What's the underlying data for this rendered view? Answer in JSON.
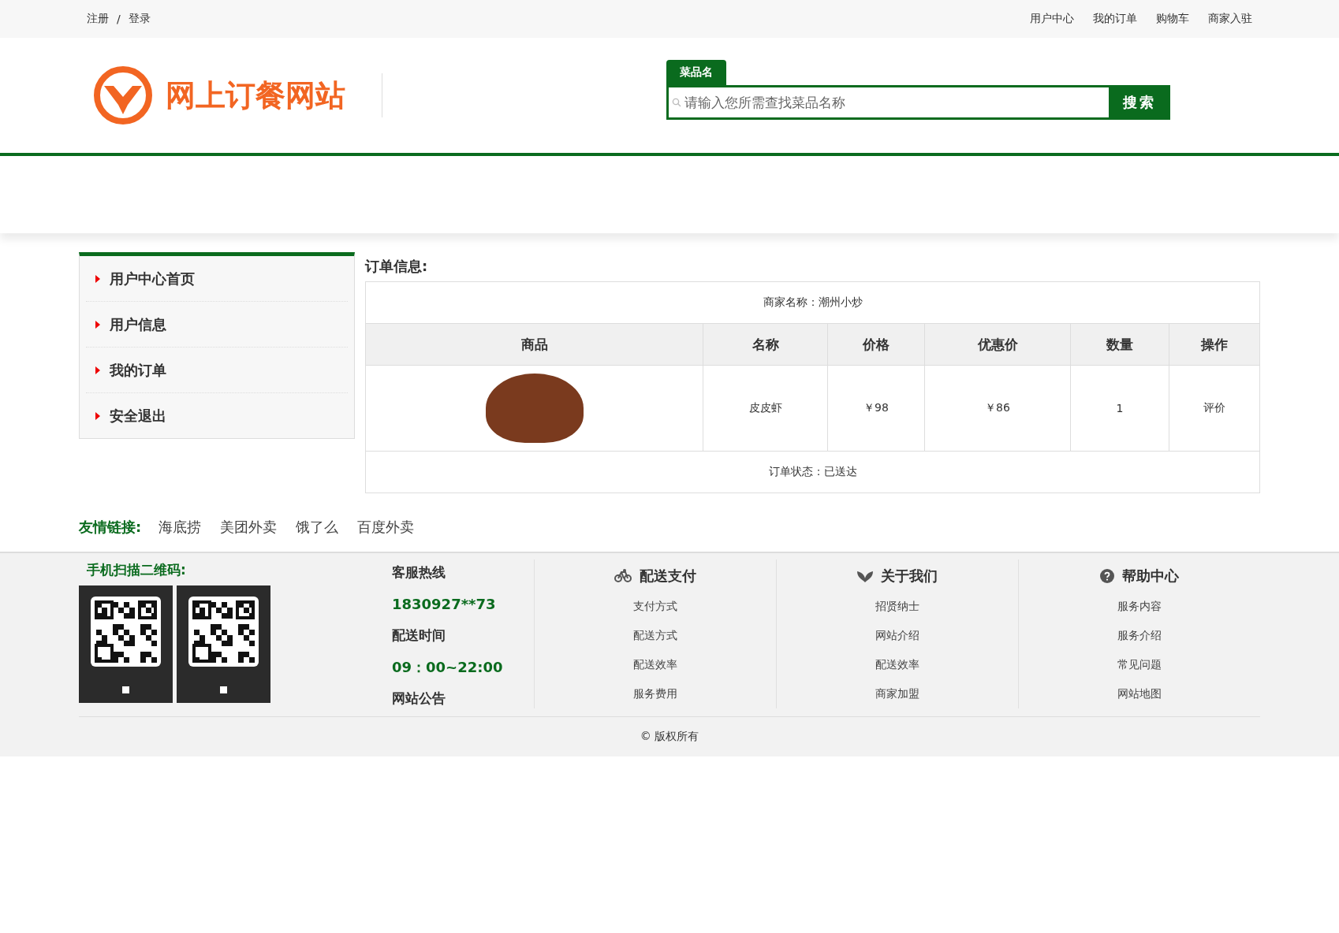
{
  "top_bar": {
    "left_links": [
      "注册",
      "登录"
    ],
    "separator": "/",
    "right_links": [
      "用户中心",
      "我的订单",
      "购物车",
      "商家入驻"
    ]
  },
  "header": {
    "site_name": "网上订餐网站",
    "search_tab": "菜品名",
    "search_placeholder": "请输入您所需查找菜品名称",
    "search_button": "搜索"
  },
  "sidebar": {
    "items": [
      "用户中心首页",
      "用户信息",
      "我的订单",
      "安全退出"
    ]
  },
  "order": {
    "title": "订单信息:",
    "merchant": "商家名称：潮州小炒",
    "columns": [
      "商品",
      "名称",
      "价格",
      "优惠价",
      "数量",
      "操作"
    ],
    "rows": [
      {
        "name": "皮皮虾",
        "price": "￥98",
        "discount_price": "￥86",
        "quantity": "1",
        "action": "评价"
      }
    ],
    "status": "订单状态：已送达"
  },
  "friend_links": {
    "label": "友情链接:",
    "links": [
      "海底捞",
      "美团外卖",
      "饿了么",
      "百度外卖"
    ]
  },
  "footer": {
    "qr_title": "手机扫描二维码:",
    "contact": [
      {
        "kind": "heading",
        "text": "客服热线"
      },
      {
        "kind": "value",
        "text": "1830927**73"
      },
      {
        "kind": "heading",
        "text": "配送时间"
      },
      {
        "kind": "value",
        "text": "09：00~22:00"
      },
      {
        "kind": "heading",
        "text": "网站公告"
      }
    ],
    "columns": [
      {
        "kind": "delivery",
        "title": "配送支付",
        "links": [
          "支付方式",
          "配送方式",
          "配送效率",
          "服务费用"
        ]
      },
      {
        "kind": "about",
        "title": "关于我们",
        "links": [
          "招贤纳士",
          "网站介绍",
          "配送效率",
          "商家加盟"
        ]
      },
      {
        "kind": "help",
        "title": "帮助中心",
        "links": [
          "服务内容",
          "服务介绍",
          "常见问题",
          "网站地图"
        ]
      }
    ],
    "copyright": "© 版权所有"
  }
}
